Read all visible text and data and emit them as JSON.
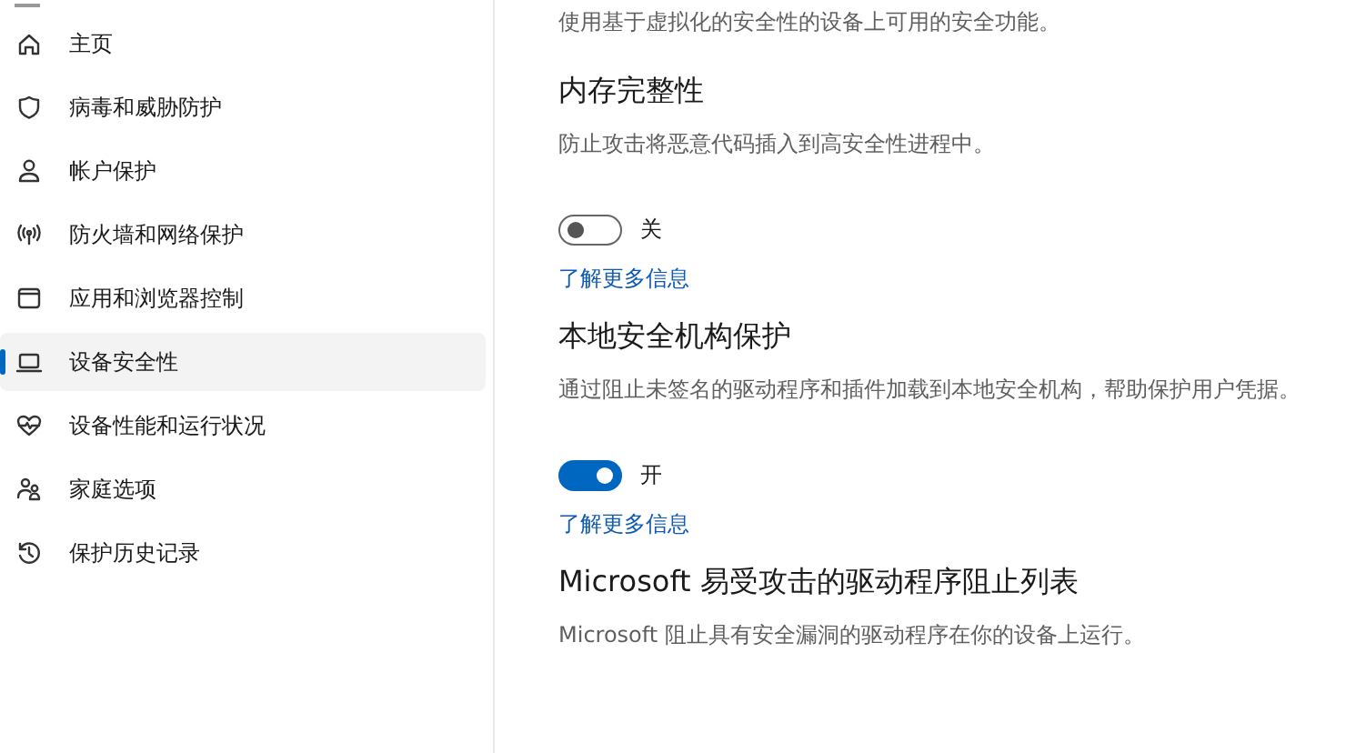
{
  "sidebar": {
    "items": [
      {
        "label": "主页",
        "selected": false
      },
      {
        "label": "病毒和威胁防护",
        "selected": false
      },
      {
        "label": "帐户保护",
        "selected": false
      },
      {
        "label": "防火墙和网络保护",
        "selected": false
      },
      {
        "label": "应用和浏览器控制",
        "selected": false
      },
      {
        "label": "设备安全性",
        "selected": true
      },
      {
        "label": "设备性能和运行状况",
        "selected": false
      },
      {
        "label": "家庭选项",
        "selected": false
      },
      {
        "label": "保护历史记录",
        "selected": false
      }
    ]
  },
  "intro": "使用基于虚拟化的安全性的设备上可用的安全功能。",
  "sections": [
    {
      "title": "内存完整性",
      "description": "防止攻击将恶意代码插入到高安全性进程中。",
      "toggle": {
        "on": false,
        "label": "关"
      },
      "link": "了解更多信息"
    },
    {
      "title": "本地安全机构保护",
      "description": "通过阻止未签名的驱动程序和插件加载到本地安全机构，帮助保护用户凭据。",
      "toggle": {
        "on": true,
        "label": "开"
      },
      "link": "了解更多信息"
    },
    {
      "title": "Microsoft 易受攻击的驱动程序阻止列表",
      "description": "Microsoft 阻止具有安全漏洞的驱动程序在你的设备上运行。"
    }
  ]
}
